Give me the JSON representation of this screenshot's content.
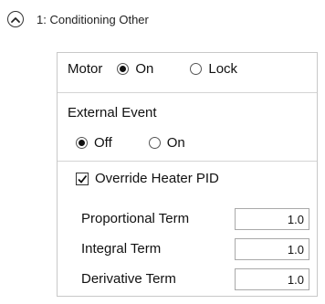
{
  "header": {
    "title": "1: Conditioning Other"
  },
  "motor": {
    "label": "Motor",
    "options": [
      {
        "label": "On",
        "selected": true
      },
      {
        "label": "Lock",
        "selected": false
      }
    ]
  },
  "external_event": {
    "label": "External Event",
    "options": [
      {
        "label": "Off",
        "selected": true
      },
      {
        "label": "On",
        "selected": false
      }
    ]
  },
  "override": {
    "label": "Override Heater PID",
    "checked": true
  },
  "pid": {
    "proportional": {
      "label": "Proportional Term",
      "value": "1.0"
    },
    "integral": {
      "label": "Integral Term",
      "value": "1.0"
    },
    "derivative": {
      "label": "Derivative Term",
      "value": "1.0"
    }
  }
}
